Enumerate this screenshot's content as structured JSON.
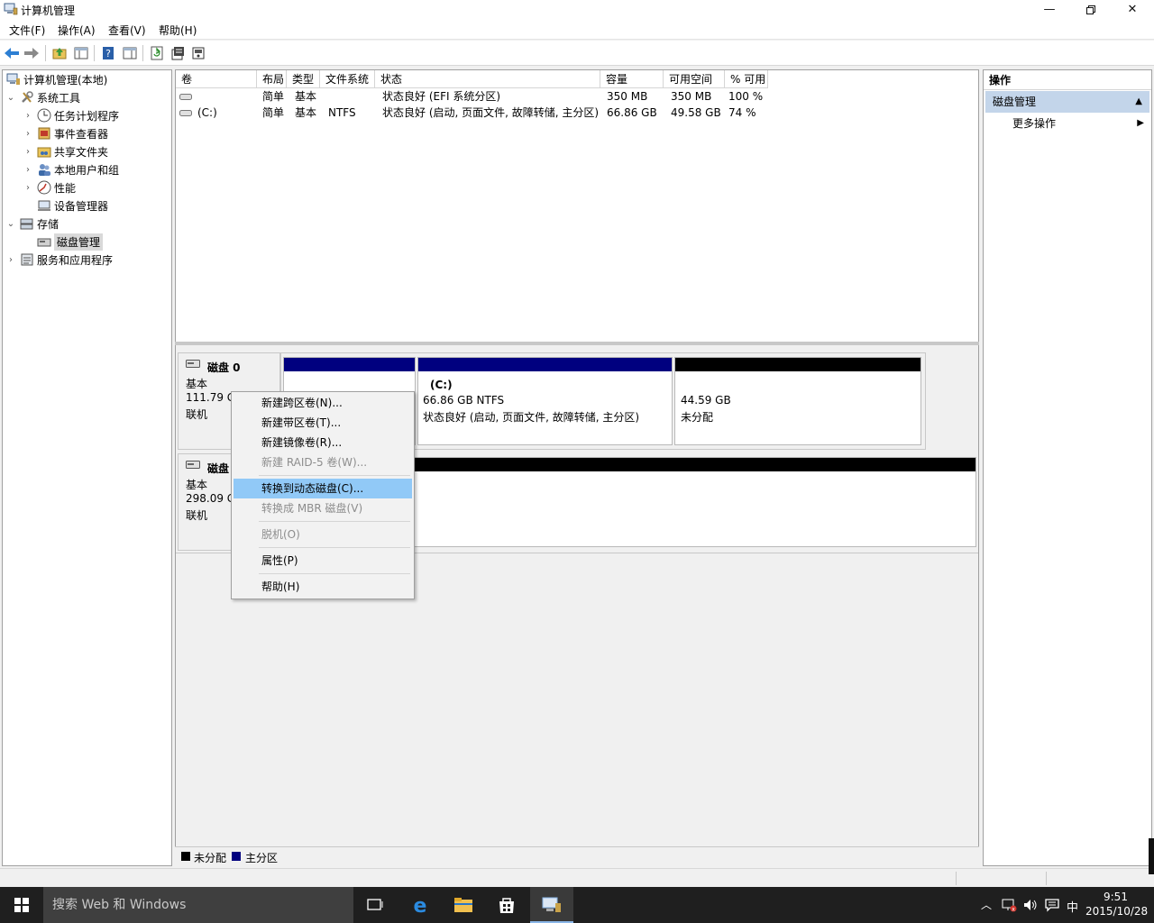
{
  "window": {
    "title": "计算机管理",
    "minimize_icon": "minimize-icon",
    "restore_icon": "restore-icon",
    "close_icon": "close-icon"
  },
  "menu": [
    "文件(F)",
    "操作(A)",
    "查看(V)",
    "帮助(H)"
  ],
  "toolbar": [
    "back-arrow-icon",
    "forward-arrow-icon",
    "up-folder-icon",
    "show-hide-tree-icon",
    "help-icon",
    "show-hide-action-icon",
    "refresh-icon",
    "properties-icon",
    "disk-icon"
  ],
  "tree": {
    "root": "计算机管理(本地)",
    "system_tools": "系统工具",
    "task_scheduler": "任务计划程序",
    "event_viewer": "事件查看器",
    "shared_folders": "共享文件夹",
    "local_users": "本地用户和组",
    "performance": "性能",
    "device_manager": "设备管理器",
    "storage": "存储",
    "disk_management": "磁盘管理",
    "services": "服务和应用程序"
  },
  "volume_table": {
    "headers": [
      "卷",
      "布局",
      "类型",
      "文件系统",
      "状态",
      "容量",
      "可用空间",
      "% 可用"
    ],
    "rows": [
      [
        "",
        "简单",
        "基本",
        "",
        "状态良好 (EFI 系统分区)",
        "350 MB",
        "350 MB",
        "100 %"
      ],
      [
        "(C:)",
        "简单",
        "基本",
        "NTFS",
        "状态良好 (启动, 页面文件, 故障转储, 主分区)",
        "66.86 GB",
        "49.58 GB",
        "74 %"
      ]
    ]
  },
  "disks": {
    "disk0": {
      "name": "磁盘 0",
      "type": "基本",
      "size": "111.79 G",
      "status": "联机",
      "c_label": "(C:)",
      "c_fs": "66.86 GB NTFS",
      "c_status": "状态良好 (启动, 页面文件, 故障转储, 主分区)",
      "unalloc_size": "44.59 GB",
      "unalloc_label": "未分配"
    },
    "disk1": {
      "name": "磁盘",
      "type": "基本",
      "size": "298.09 G",
      "status": "联机"
    }
  },
  "legend": {
    "unallocated": "未分配",
    "primary": "主分区",
    "unallocated_color": "#000000",
    "primary_color": "#00007f"
  },
  "actions": {
    "header": "操作",
    "section": "磁盘管理",
    "more": "更多操作"
  },
  "context_menu": {
    "spanned": "新建跨区卷(N)...",
    "striped": "新建带区卷(T)...",
    "mirrored": "新建镜像卷(R)...",
    "raid5": "新建 RAID-5 卷(W)...",
    "to_dynamic": "转换到动态磁盘(C)...",
    "to_mbr": "转换成 MBR 磁盘(V)",
    "offline": "脱机(O)",
    "properties": "属性(P)",
    "help": "帮助(H)"
  },
  "taskbar": {
    "search_placeholder": "搜索 Web 和 Windows",
    "time": "9:51",
    "date": "2015/10/28",
    "ime": "中"
  }
}
